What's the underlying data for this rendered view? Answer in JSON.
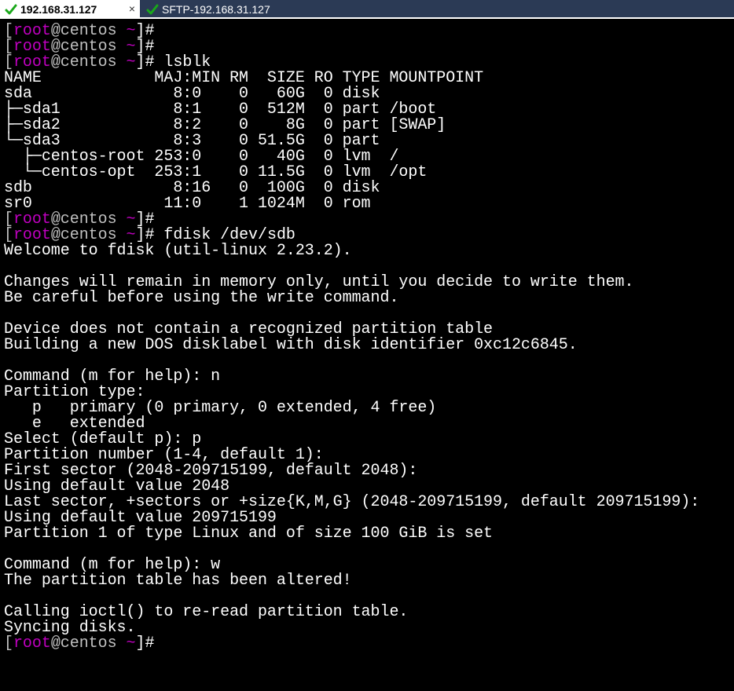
{
  "tabs": {
    "active_label": "192.168.31.127",
    "inactive_label": "SFTP-192.168.31.127",
    "close_glyph": "×"
  },
  "colors": {
    "bracket": "#c0c0c0",
    "user": "#c000c0",
    "host": "#c0c0c0",
    "output": "#ffffff",
    "background": "#000000",
    "tab_check": "#1aa81a"
  },
  "prompt": {
    "open_bracket": "[",
    "user": "root",
    "at_host": "@centos ",
    "tilde": "~",
    "close": "]#"
  },
  "lines": [
    {
      "type": "prompt",
      "cmd": ""
    },
    {
      "type": "prompt",
      "cmd": ""
    },
    {
      "type": "prompt",
      "cmd": " lsblk"
    },
    {
      "type": "out",
      "text": "NAME            MAJ:MIN RM  SIZE RO TYPE MOUNTPOINT"
    },
    {
      "type": "out",
      "text": "sda               8:0    0   60G  0 disk"
    },
    {
      "type": "out",
      "text": "├─sda1            8:1    0  512M  0 part /boot"
    },
    {
      "type": "out",
      "text": "├─sda2            8:2    0    8G  0 part [SWAP]"
    },
    {
      "type": "out",
      "text": "└─sda3            8:3    0 51.5G  0 part"
    },
    {
      "type": "out",
      "text": "  ├─centos-root 253:0    0   40G  0 lvm  /"
    },
    {
      "type": "out",
      "text": "  └─centos-opt  253:1    0 11.5G  0 lvm  /opt"
    },
    {
      "type": "out",
      "text": "sdb               8:16   0  100G  0 disk"
    },
    {
      "type": "out",
      "text": "sr0              11:0    1 1024M  0 rom"
    },
    {
      "type": "prompt",
      "cmd": ""
    },
    {
      "type": "prompt",
      "cmd": " fdisk /dev/sdb"
    },
    {
      "type": "out",
      "text": "Welcome to fdisk (util-linux 2.23.2)."
    },
    {
      "type": "out",
      "text": ""
    },
    {
      "type": "out",
      "text": "Changes will remain in memory only, until you decide to write them."
    },
    {
      "type": "out",
      "text": "Be careful before using the write command."
    },
    {
      "type": "out",
      "text": ""
    },
    {
      "type": "out",
      "text": "Device does not contain a recognized partition table"
    },
    {
      "type": "out",
      "text": "Building a new DOS disklabel with disk identifier 0xc12c6845."
    },
    {
      "type": "out",
      "text": ""
    },
    {
      "type": "out",
      "text": "Command (m for help): n"
    },
    {
      "type": "out",
      "text": "Partition type:"
    },
    {
      "type": "out",
      "text": "   p   primary (0 primary, 0 extended, 4 free)"
    },
    {
      "type": "out",
      "text": "   e   extended"
    },
    {
      "type": "out",
      "text": "Select (default p): p"
    },
    {
      "type": "out",
      "text": "Partition number (1-4, default 1):"
    },
    {
      "type": "out",
      "text": "First sector (2048-209715199, default 2048):"
    },
    {
      "type": "out",
      "text": "Using default value 2048"
    },
    {
      "type": "out",
      "text": "Last sector, +sectors or +size{K,M,G} (2048-209715199, default 209715199):"
    },
    {
      "type": "out",
      "text": "Using default value 209715199"
    },
    {
      "type": "out",
      "text": "Partition 1 of type Linux and of size 100 GiB is set"
    },
    {
      "type": "out",
      "text": ""
    },
    {
      "type": "out",
      "text": "Command (m for help): w"
    },
    {
      "type": "out",
      "text": "The partition table has been altered!"
    },
    {
      "type": "out",
      "text": ""
    },
    {
      "type": "out",
      "text": "Calling ioctl() to re-read partition table."
    },
    {
      "type": "out",
      "text": "Syncing disks."
    },
    {
      "type": "prompt",
      "cmd": ""
    }
  ]
}
